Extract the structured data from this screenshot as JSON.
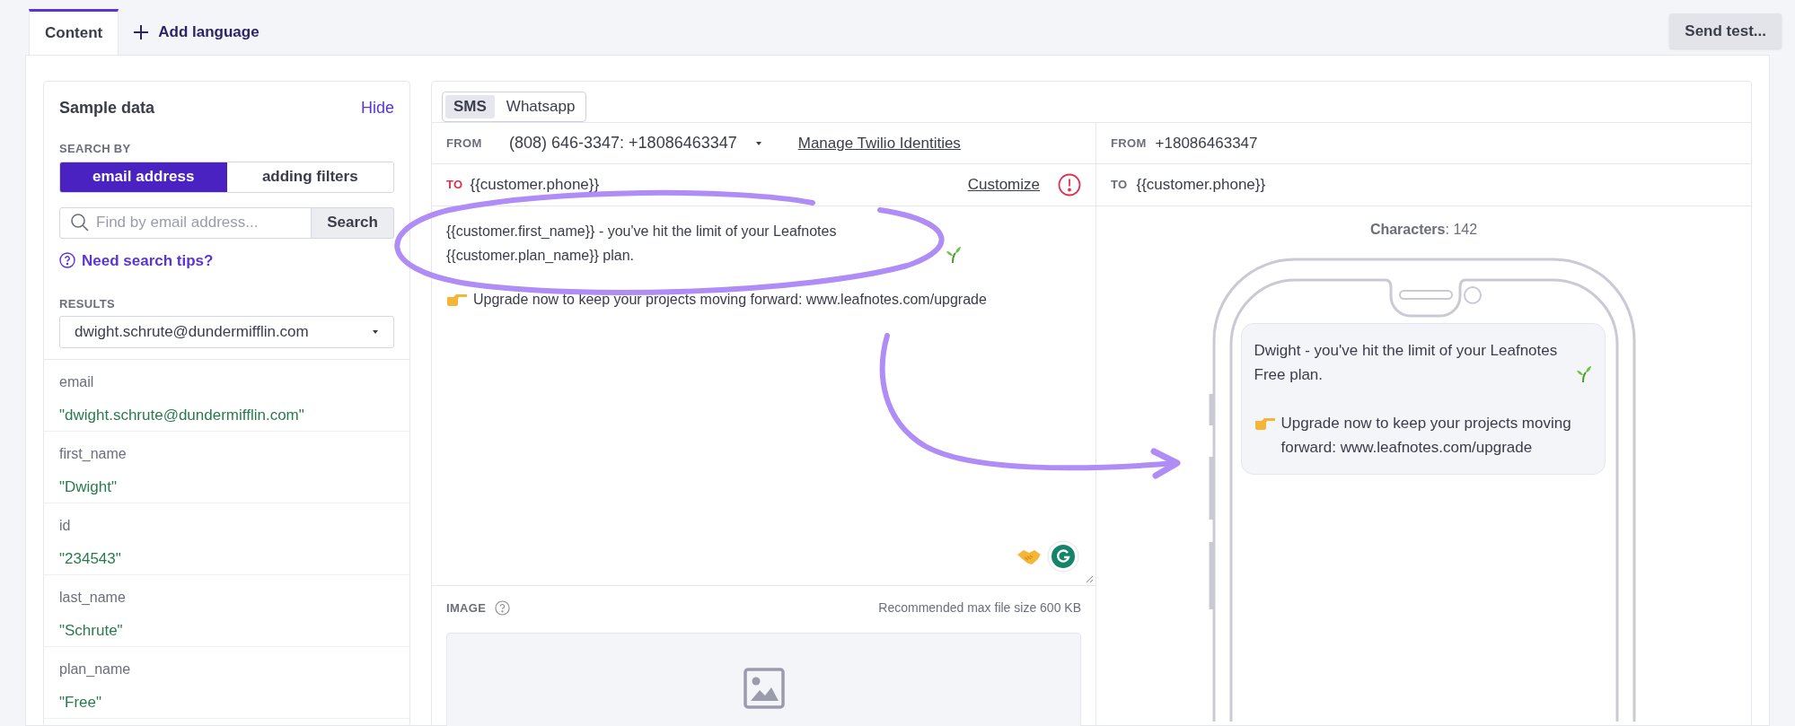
{
  "tabs": [
    {
      "label": "Content",
      "selected": true
    }
  ],
  "add_language": "Add language",
  "send_test": "Send test...",
  "sample_data": {
    "title": "Sample data",
    "hide": "Hide",
    "search_by_label": "SEARCH BY",
    "search_by_options": [
      {
        "label": "email address",
        "selected": true
      },
      {
        "label": "adding filters",
        "selected": false
      }
    ],
    "search": {
      "placeholder": "Find by email address...",
      "button": "Search"
    },
    "tips": "Need search tips?",
    "results_label": "RESULTS",
    "result": "dwight.schrute@dundermifflin.com",
    "fields": [
      {
        "name": "email",
        "value": "\"dwight.schrute@dundermifflin.com\""
      },
      {
        "name": "first_name",
        "value": "\"Dwight\""
      },
      {
        "name": "id",
        "value": "\"234543\""
      },
      {
        "name": "last_name",
        "value": "\"Schrute\""
      },
      {
        "name": "plan_name",
        "value": "\"Free\""
      }
    ]
  },
  "editor": {
    "channels": [
      {
        "label": "SMS",
        "selected": true
      },
      {
        "label": "Whatsapp",
        "selected": false
      }
    ],
    "from_label": "FROM",
    "from_value": "(808) 646-3347: +18086463347",
    "manage_link": "Manage Twilio Identities",
    "to_label": "TO",
    "to_value": "{{customer.phone}}",
    "customize_link": "Customize",
    "message": [
      {
        "text": "{{customer.first_name}} - you've hit the limit of your Leafnotes {{customer.plan_name}} plan.",
        "kind": "trailing"
      },
      {
        "text": "Upgrade now to keep your projects moving forward: www.leafnotes.com/upgrade",
        "kind": "leading"
      }
    ],
    "image_label": "IMAGE",
    "image_hint": "Recommended max file size 600 KB"
  },
  "preview": {
    "from_label": "FROM",
    "from_value": "+18086463347",
    "to_label": "TO",
    "to_value": "{{customer.phone}}",
    "characters": "**Characters**: 142",
    "bubble": [
      {
        "text": "Dwight - you've hit the limit of your Leafnotes Free plan.",
        "kind": "trailing"
      },
      {
        "text": "Upgrade now to keep your projects moving forward: www.leafnotes.com/upgrade",
        "kind": "leading"
      }
    ]
  }
}
